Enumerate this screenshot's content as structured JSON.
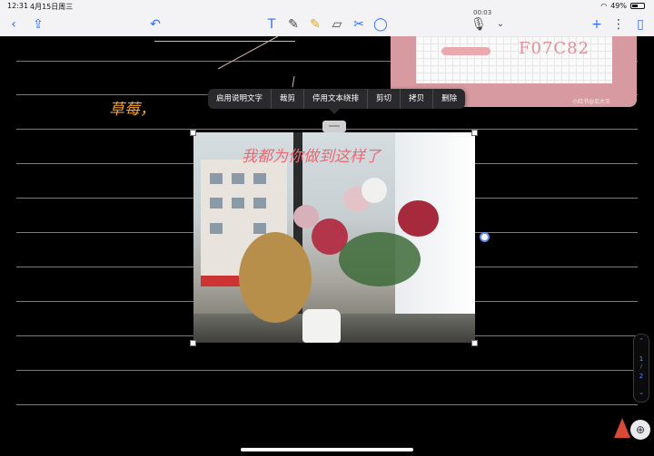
{
  "status": {
    "time": "12:31",
    "date": "4月15日周三",
    "battery": "49%"
  },
  "toolbar": {
    "back_icon": "chevron-left-icon",
    "share_icon": "share-icon",
    "undo_icon": "undo-icon",
    "tools": [
      "text-tool-icon",
      "pen-icon",
      "highlighter-icon",
      "eraser-icon",
      "lasso-icon",
      "shapes-icon"
    ],
    "recording_time": "00:03",
    "mic_icon": "microphone-icon",
    "add_icon": "plus-icon",
    "more_icon": "more-icon",
    "pages_icon": "pages-icon"
  },
  "sticky": {
    "code": "F07C82",
    "watermark": "小红书@瓜大王"
  },
  "handwriting": {
    "text": "草莓，"
  },
  "context_menu": {
    "items": [
      "启用说明文字",
      "裁剪",
      "停用文本绕排",
      "剪切",
      "拷贝",
      "删除"
    ]
  },
  "photo": {
    "caption": "我都为你做到这样了"
  },
  "pager": {
    "current": "1",
    "total": "2"
  },
  "colors": {
    "accent": "#2f6fff",
    "highlight": "#f5a133",
    "sticky_pink": "#d69aa0"
  }
}
